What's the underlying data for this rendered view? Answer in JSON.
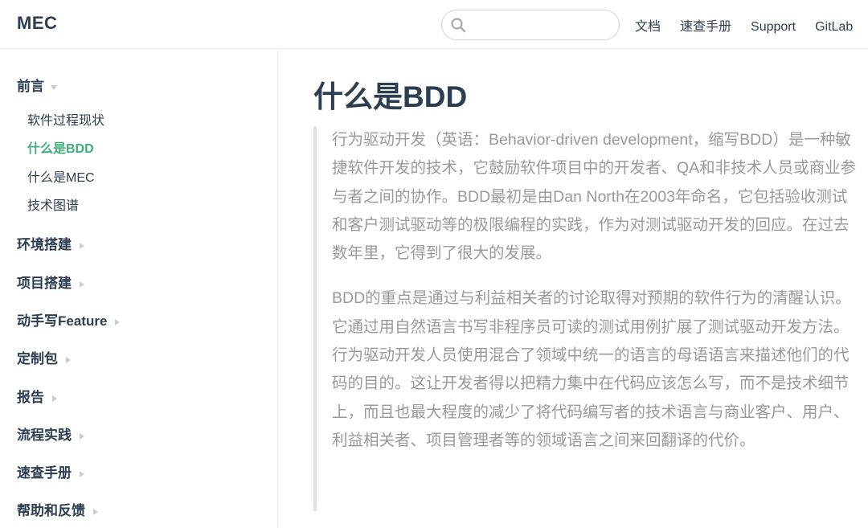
{
  "header": {
    "logo": "MEC",
    "search": {
      "value": "",
      "placeholder": ""
    },
    "nav_links": [
      "文档",
      "速查手册",
      "Support",
      "GitLab"
    ]
  },
  "sidebar": {
    "groups": [
      {
        "label": "前言",
        "expanded": true,
        "items": [
          {
            "label": "软件过程现状",
            "active": false
          },
          {
            "label": "什么是BDD",
            "active": true
          },
          {
            "label": "什么是MEC",
            "active": false
          },
          {
            "label": "技术图谱",
            "active": false
          }
        ]
      },
      {
        "label": "环境搭建",
        "expanded": false
      },
      {
        "label": "项目搭建",
        "expanded": false
      },
      {
        "label": "动手写Feature",
        "expanded": false
      },
      {
        "label": "定制包",
        "expanded": false
      },
      {
        "label": "报告",
        "expanded": false
      },
      {
        "label": "流程实践",
        "expanded": false
      },
      {
        "label": "速查手册",
        "expanded": false
      },
      {
        "label": "帮助和反馈",
        "expanded": false
      }
    ]
  },
  "content": {
    "title": "什么是BDD",
    "paragraphs": [
      "行为驱动开发（英语：Behavior-driven development，缩写BDD）是一种敏捷软件开发的技术，它鼓励软件项目中的开发者、QA和非技术人员或商业参与者之间的协作。BDD最初是由Dan North在2003年命名，它包括验收测试和客户测试驱动等的极限编程的实践，作为对测试驱动开发的回应。在过去数年里，它得到了很大的发展。",
      "BDD的重点是通过与利益相关者的讨论取得对预期的软件行为的清醒认识。它通过用自然语言书写非程序员可读的测试用例扩展了测试驱动开发方法。行为驱动开发人员使用混合了领域中统一的语言的母语语言来描述他们的代码的目的。这让开发者得以把精力集中在代码应该怎么写，而不是技术细节上，而且也最大程度的减少了将代码编写者的技术语言与商业客户、用户、利益相关者、项目管理者等的领域语言之间来回翻译的代价。"
    ]
  },
  "colors": {
    "accent": "#3eaf7c",
    "text": "#2c3e50",
    "quote_text": "#999999",
    "quote_border": "#dfe2e5"
  }
}
